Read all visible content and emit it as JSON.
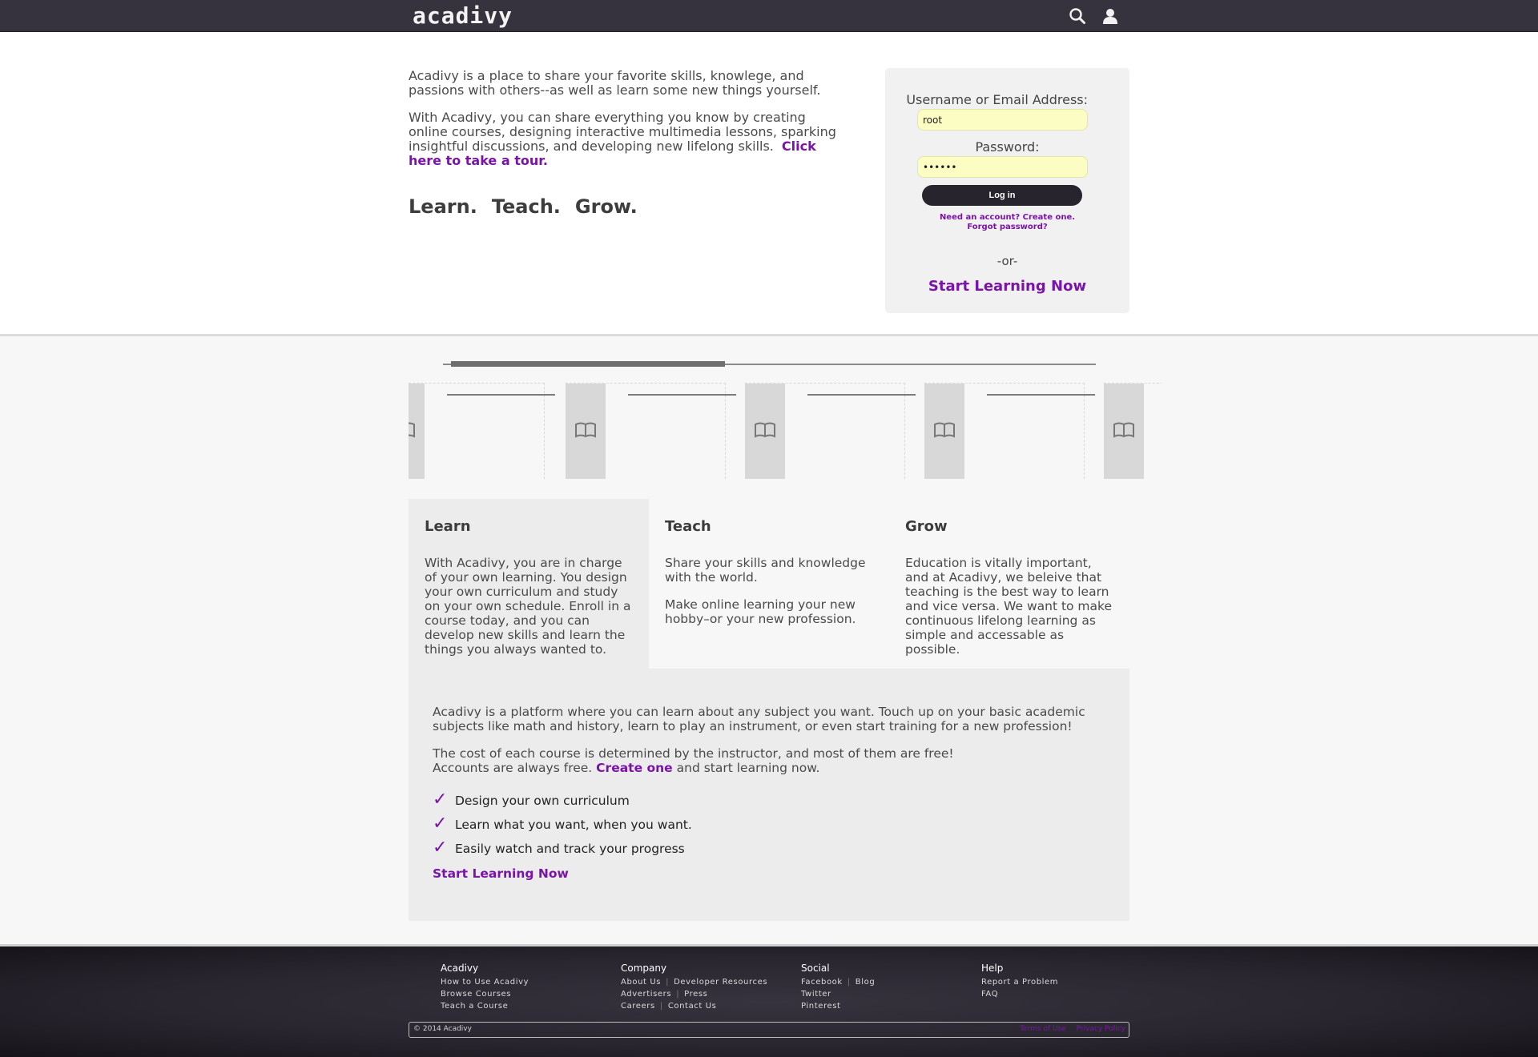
{
  "header": {
    "logo": "acadivy",
    "icons": [
      "search-icon",
      "user-icon"
    ]
  },
  "intro": {
    "p1": "Acadivy is a place to share your favorite skills, knowlege, and passions with others--as well as learn some new things yourself.",
    "p2": "With Acadivy, you can share everything you know by creating online courses, designing interactive multimedia lessons, sparking insightful discussions, and developing new lifelong skills.",
    "tour_link": "Click here to take a tour.",
    "tagline": [
      "Learn.",
      "Teach.",
      "Grow."
    ]
  },
  "login": {
    "username_label": "Username or Email Address:",
    "username_value": "root",
    "password_label": "Password:",
    "password_value": "••••••",
    "login_button": "Log in",
    "create_account": "Need an account? Create one.",
    "forgot_password": "Forgot password?",
    "or": "-or-",
    "start_learning": "Start Learning Now"
  },
  "carousel": {
    "progress_fraction": 0.42,
    "card_icons": [
      "book-icon",
      "book-icon",
      "book-icon",
      "book-icon",
      "book-icon"
    ]
  },
  "features": {
    "learn": {
      "title": "Learn",
      "text": "With Acadivy, you are in charge of your own learning. You design your own curriculum and study on your own schedule. Enroll in a course today, and you can develop new skills and learn the things you always wanted to."
    },
    "teach": {
      "title": "Teach",
      "text1": "Share your skills and knowledge with the world.",
      "text2": "Make online learning your new hobby–or your new profession."
    },
    "grow": {
      "title": "Grow",
      "text": "Education is vitally important, and at Acadivy, we beleive that teaching is the best way to learn and vice versa. We want to make continuous lifelong learning as simple and accessable as possible."
    }
  },
  "platform": {
    "p1": "Acadivy is a platform where you can learn about any subject you want. Touch up on your basic academic subjects like math and history, learn to play an instrument, or even start training for a new profession!",
    "p2_line1": "The cost of each course is determined by the instructor, and most of them are free!",
    "p2_line2_pre": "Accounts are always free.",
    "p2_link": "Create one",
    "p2_line2_post": "and start learning now.",
    "checks": [
      "Design your own curriculum",
      "Learn what you want, when you want.",
      "Easily watch and track your progress"
    ],
    "tick": "✓",
    "start_learning": "Start Learning Now"
  },
  "footer": {
    "acadivy": {
      "title": "Acadivy",
      "links": [
        "How to Use Acadivy",
        "Browse Courses",
        "Teach a Course"
      ]
    },
    "company": {
      "title": "Company",
      "links": [
        "About Us",
        "Developer Resources",
        "Advertisers",
        "Press",
        "Careers",
        "Contact Us"
      ]
    },
    "social": {
      "title": "Social",
      "links": [
        "Facebook",
        "Blog",
        "Twitter",
        "Pinterest"
      ]
    },
    "help": {
      "title": "Help",
      "links": [
        "Report a Problem",
        "FAQ"
      ]
    },
    "copyright": "© 2014 Acadivy",
    "terms": "Terms of Use",
    "privacy": "Privacy Policy",
    "separator": "|"
  },
  "colors": {
    "accent": "#7a14a8",
    "nav_bg": "#37333e",
    "input_bg": "#fbfdc2"
  }
}
